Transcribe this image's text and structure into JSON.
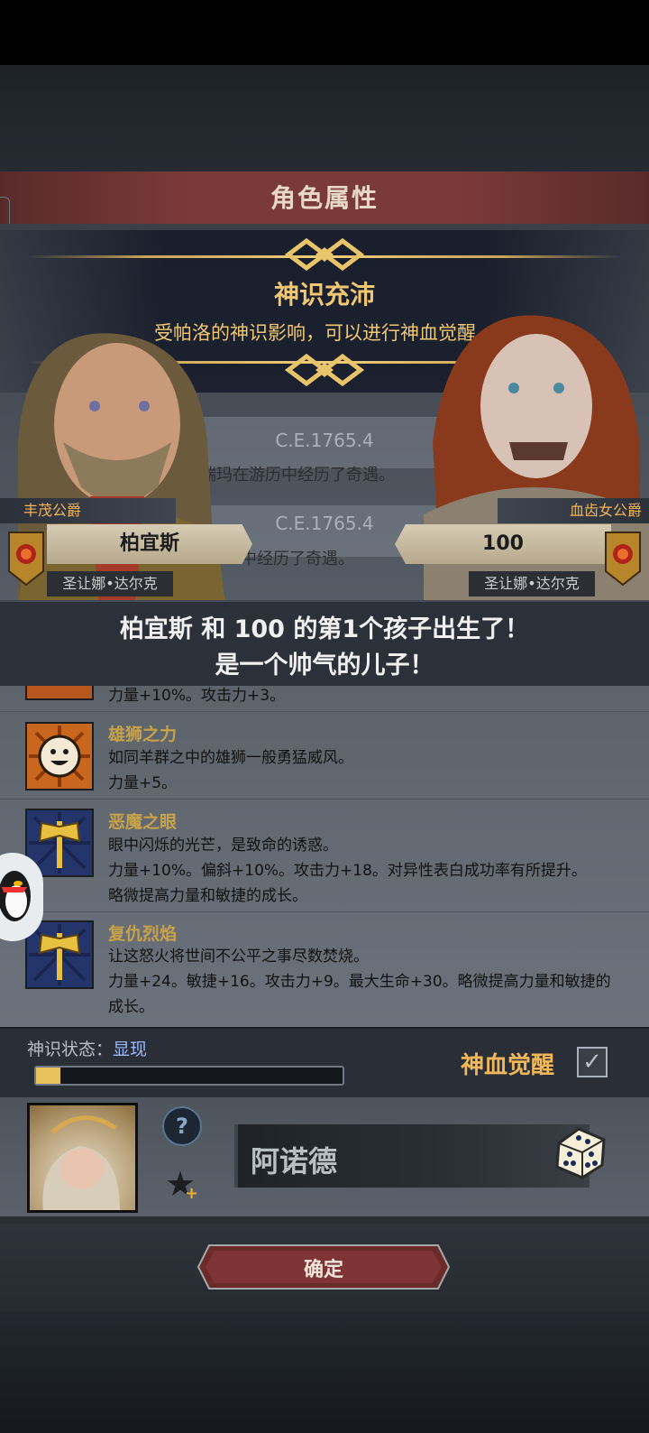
{
  "header": {
    "title": "角色属性"
  },
  "banner": {
    "title": "神识充沛",
    "subtitle": "受帕洛的神识影响，可以进行神血觉醒。"
  },
  "events": [
    {
      "date": "C.E.1765.4",
      "text": "瑞玛在游历中经历了奇遇。"
    },
    {
      "date": "C.E.1765.4",
      "text": "中经历了奇遇。"
    }
  ],
  "father": {
    "title": "丰茂公爵",
    "name": "柏宜斯",
    "family": "圣让娜•达尔克"
  },
  "mother": {
    "title": "血齿女公爵",
    "name": "100",
    "family": "圣让娜•达尔克"
  },
  "birth": {
    "line1": "柏宜斯 和 100 的第1个孩子出生了！",
    "line2": "是一个帅气的儿子！"
  },
  "traits": [
    {
      "name": "",
      "desc": "力量+10%。攻击力+3。",
      "icon": "trait-icon"
    },
    {
      "name": "雄狮之力",
      "desc": "如同羊群之中的雄狮一般勇猛威风。\n力量+5。",
      "icon": "smile-icon"
    },
    {
      "name": "恶魔之眼",
      "desc": "眼中闪烁的光芒，是致命的诱惑。\n力量+10%。偏斜+10%。攻击力+18。对异性表白成功率有所提升。\n略微提高力量和敏捷的成长。",
      "icon": "axe-icon"
    },
    {
      "name": "复仇烈焰",
      "desc": "让这怒火将世间不公平之事尽数焚烧。\n力量+24。敏捷+16。攻击力+9。最大生命+30。略微提高力量和敏捷的成长。",
      "icon": "axe-icon"
    }
  ],
  "status": {
    "label": "神识状态：",
    "value": "显现",
    "progress": 0.08,
    "awaken_label": "神血觉醒",
    "awaken_checked": true
  },
  "child": {
    "name": "阿诺德",
    "help_icon": "question-icon",
    "favorite_icon": "star-plus-icon",
    "random_icon": "dice-icon"
  },
  "confirm_label": "确定",
  "colors": {
    "gold": "#f0c772",
    "status_blue": "#9cb8ff",
    "header_red": "#7b3a3a"
  }
}
